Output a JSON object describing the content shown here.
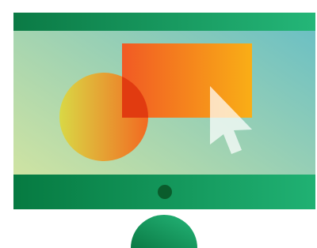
{
  "illustration": {
    "subject": "monitor-with-shapes-and-cursor-icon",
    "colors": {
      "screen_gradient_start": "#D9E79F",
      "screen_gradient_end": "#67BEC5",
      "top_bar_start": "#0B7A45",
      "top_bar_end": "#24B678",
      "bottom_bar_start": "#067A41",
      "bottom_bar_end": "#20B173",
      "power_button": "#0A5C2C",
      "rectangle_start": "#F15A24",
      "rectangle_end": "#F9AE16",
      "circle_start": "#D9D845",
      "circle_end": "#F26A21",
      "overlap": "#E13B10",
      "cursor": "#FFFFFF",
      "stand_start": "#0B7A45",
      "stand_end": "#24B678"
    }
  }
}
